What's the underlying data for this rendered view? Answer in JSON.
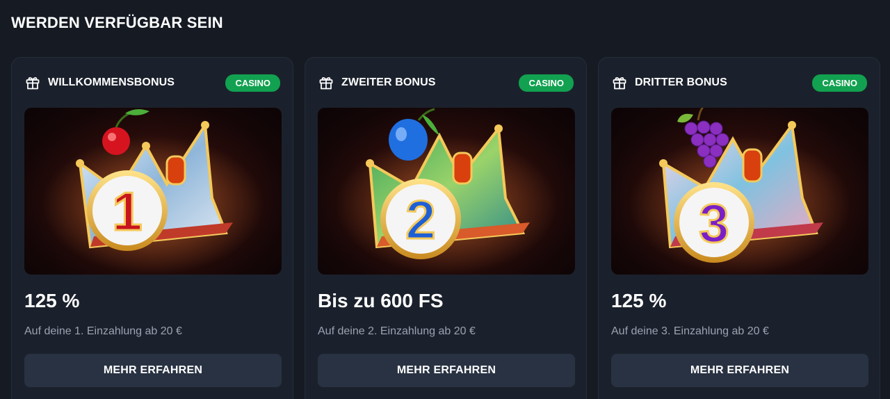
{
  "section": {
    "title": "WERDEN VERFÜGBAR SEIN"
  },
  "colors": {
    "badge": "#12a150",
    "button": "#283242",
    "card": "#1b212c"
  },
  "cards": [
    {
      "title": "WILLKOMMENSBONUS",
      "badge": "CASINO",
      "icon": "gift-icon",
      "art": {
        "number": "1",
        "fruit": "cherry",
        "number_color": "#c8141e"
      },
      "amount": "125 %",
      "description": "Auf deine 1. Einzahlung ab 20 €",
      "button_label": "MEHR ERFAHREN"
    },
    {
      "title": "ZWEITER BONUS",
      "badge": "CASINO",
      "icon": "gift-icon",
      "art": {
        "number": "2",
        "fruit": "plum",
        "number_color": "#1f5fd6"
      },
      "amount": "Bis zu 600 FS",
      "description": "Auf deine 2. Einzahlung ab 20 €",
      "button_label": "MEHR ERFAHREN"
    },
    {
      "title": "DRITTER BONUS",
      "badge": "CASINO",
      "icon": "gift-icon",
      "art": {
        "number": "3",
        "fruit": "grapes",
        "number_color": "#7a1fc8"
      },
      "amount": "125 %",
      "description": "Auf deine 3. Einzahlung ab 20 €",
      "button_label": "MEHR ERFAHREN"
    }
  ]
}
